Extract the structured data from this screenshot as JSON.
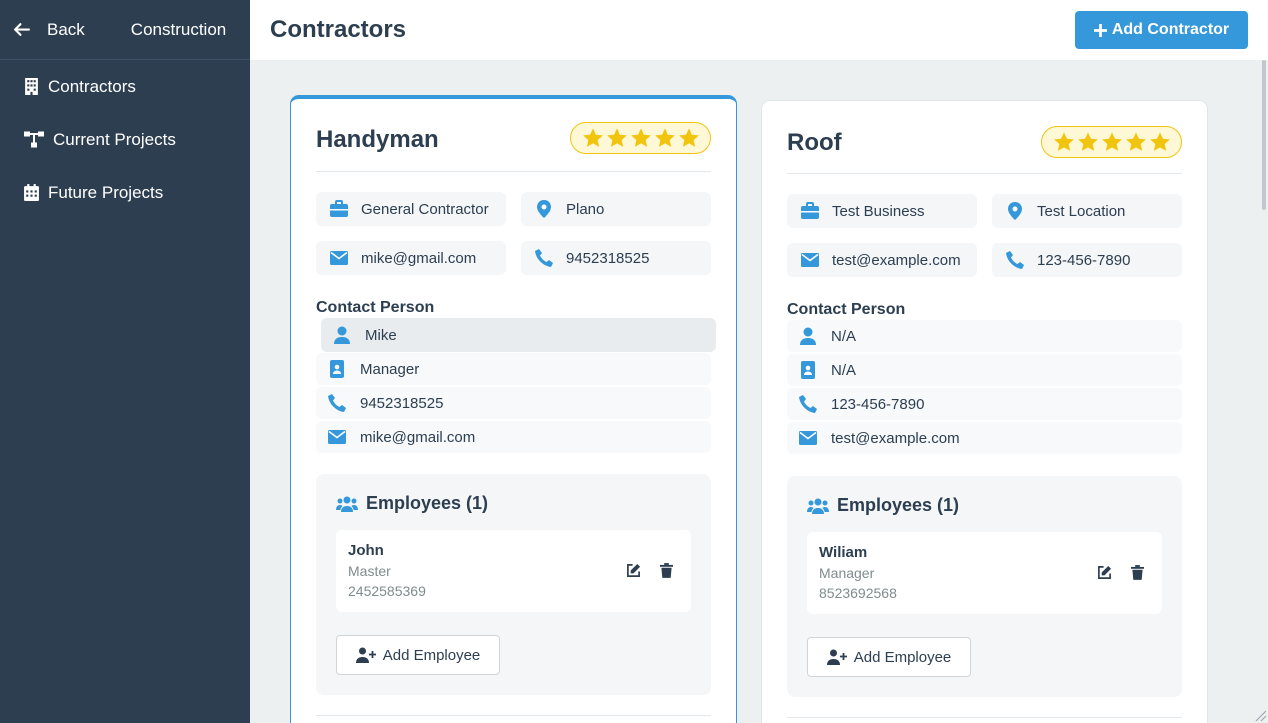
{
  "sidebar": {
    "back_label": "Back",
    "brand": "Construction",
    "items": [
      {
        "label": "Contractors",
        "icon": "building-icon"
      },
      {
        "label": "Current Projects",
        "icon": "sitemap-icon"
      },
      {
        "label": "Future Projects",
        "icon": "calendar-icon"
      }
    ]
  },
  "header": {
    "title": "Contractors",
    "add_button": "Add Contractor"
  },
  "contractors": [
    {
      "name": "Handyman",
      "rating": 5,
      "business_type": "General Contractor",
      "location": "Plano",
      "email": "mike@gmail.com",
      "phone": "9452318525",
      "contact_label": "Contact Person",
      "contact": {
        "name": "Mike",
        "title": "Manager",
        "phone": "9452318525",
        "email": "mike@gmail.com"
      },
      "employees_label": "Employees (1)",
      "employees": [
        {
          "name": "John",
          "role": "Master",
          "phone": "2452585369"
        }
      ],
      "add_employee": "Add Employee"
    },
    {
      "name": "Roof",
      "rating": 5,
      "business_type": "Test Business",
      "location": "Test Location",
      "email": "test@example.com",
      "phone": "123-456-7890",
      "contact_label": "Contact Person",
      "contact": {
        "name": "N/A",
        "title": "N/A",
        "phone": "123-456-7890",
        "email": "test@example.com"
      },
      "employees_label": "Employees (1)",
      "employees": [
        {
          "name": "Wiliam",
          "role": "Manager",
          "phone": "8523692568"
        }
      ],
      "add_employee": "Add Employee"
    }
  ],
  "colors": {
    "sidebar_bg": "#2c3e50",
    "accent": "#3498db",
    "star": "#f1c40f",
    "page_bg": "#ecf0f1"
  }
}
